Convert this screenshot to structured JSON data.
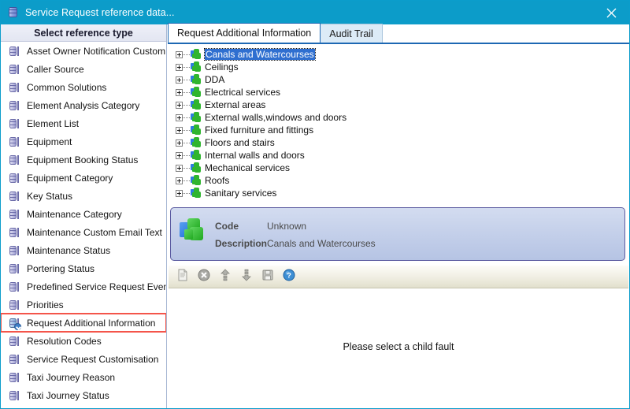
{
  "window": {
    "title": "Service Request reference data...",
    "title_icon": "database-icon",
    "close_label": "✕",
    "titlebar_color": "#0c9cc9"
  },
  "sidebar": {
    "header": "Select reference type",
    "items": [
      {
        "label": "Asset Owner Notification Custom...",
        "icon": "database-icon",
        "selected": false
      },
      {
        "label": "Caller Source",
        "icon": "database-icon",
        "selected": false
      },
      {
        "label": "Common Solutions",
        "icon": "database-icon",
        "selected": false
      },
      {
        "label": "Element Analysis Category",
        "icon": "database-icon",
        "selected": false
      },
      {
        "label": "Element List",
        "icon": "database-icon",
        "selected": false
      },
      {
        "label": "Equipment",
        "icon": "database-icon",
        "selected": false
      },
      {
        "label": "Equipment Booking Status",
        "icon": "database-icon",
        "selected": false
      },
      {
        "label": "Equipment Category",
        "icon": "database-icon",
        "selected": false
      },
      {
        "label": "Key Status",
        "icon": "database-icon",
        "selected": false
      },
      {
        "label": "Maintenance Category",
        "icon": "database-icon",
        "selected": false
      },
      {
        "label": "Maintenance Custom Email Text",
        "icon": "database-icon",
        "selected": false
      },
      {
        "label": "Maintenance Status",
        "icon": "database-icon",
        "selected": false
      },
      {
        "label": "Portering Status",
        "icon": "database-icon",
        "selected": false
      },
      {
        "label": "Predefined Service Request Events",
        "icon": "database-icon",
        "selected": false
      },
      {
        "label": "Priorities",
        "icon": "database-icon",
        "selected": false
      },
      {
        "label": "Request Additional Information",
        "icon": "database-refresh-icon",
        "selected": true
      },
      {
        "label": "Resolution Codes",
        "icon": "database-icon",
        "selected": false
      },
      {
        "label": "Service Request Customisation",
        "icon": "database-icon",
        "selected": false
      },
      {
        "label": "Taxi Journey Reason",
        "icon": "database-icon",
        "selected": false
      },
      {
        "label": "Taxi Journey Status",
        "icon": "database-icon",
        "selected": false
      }
    ],
    "highlight_color": "#f4554a"
  },
  "tabs": [
    {
      "label": "Request Additional Information",
      "active": true
    },
    {
      "label": "Audit Trail",
      "active": false
    }
  ],
  "tree": {
    "nodes": [
      {
        "label": "Canals and Watercourses",
        "expander": "plus",
        "icon": "puzzle-icon",
        "selected": true
      },
      {
        "label": "Ceilings",
        "expander": "plus",
        "icon": "puzzle-icon",
        "selected": false
      },
      {
        "label": "DDA",
        "expander": "plus",
        "icon": "puzzle-icon",
        "selected": false
      },
      {
        "label": "Electrical services",
        "expander": "plus",
        "icon": "puzzle-icon",
        "selected": false
      },
      {
        "label": "External areas",
        "expander": "plus",
        "icon": "puzzle-icon",
        "selected": false
      },
      {
        "label": "External walls,windows and doors",
        "expander": "plus",
        "icon": "puzzle-icon",
        "selected": false
      },
      {
        "label": "Fixed furniture and fittings",
        "expander": "plus",
        "icon": "puzzle-icon",
        "selected": false
      },
      {
        "label": "Floors and stairs",
        "expander": "plus",
        "icon": "puzzle-icon",
        "selected": false
      },
      {
        "label": "Internal walls and doors",
        "expander": "plus",
        "icon": "puzzle-icon",
        "selected": false
      },
      {
        "label": "Mechanical services",
        "expander": "plus",
        "icon": "puzzle-icon",
        "selected": false
      },
      {
        "label": "Roofs",
        "expander": "plus",
        "icon": "puzzle-icon",
        "selected": false
      },
      {
        "label": "Sanitary services",
        "expander": "plus",
        "icon": "puzzle-icon",
        "selected": false
      }
    ],
    "selection_color": "#2f6fd0"
  },
  "detail": {
    "icon": "puzzle-icon",
    "code_label": "Code",
    "code_value": "Unknown",
    "description_label": "Description",
    "description_value": "Canals and Watercourses"
  },
  "toolbar": {
    "buttons": [
      {
        "name": "new-record-button",
        "icon": "document-icon",
        "enabled": false
      },
      {
        "name": "delete-record-button",
        "icon": "delete-circle-icon",
        "enabled": false
      },
      {
        "name": "move-up-button",
        "icon": "arrow-up-icon",
        "enabled": false
      },
      {
        "name": "move-down-button",
        "icon": "arrow-down-icon",
        "enabled": false
      },
      {
        "name": "save-button",
        "icon": "floppy-disk-icon",
        "enabled": false
      },
      {
        "name": "help-button",
        "icon": "help-question-icon",
        "enabled": true
      }
    ]
  },
  "message": {
    "text": "Please select a child fault"
  }
}
